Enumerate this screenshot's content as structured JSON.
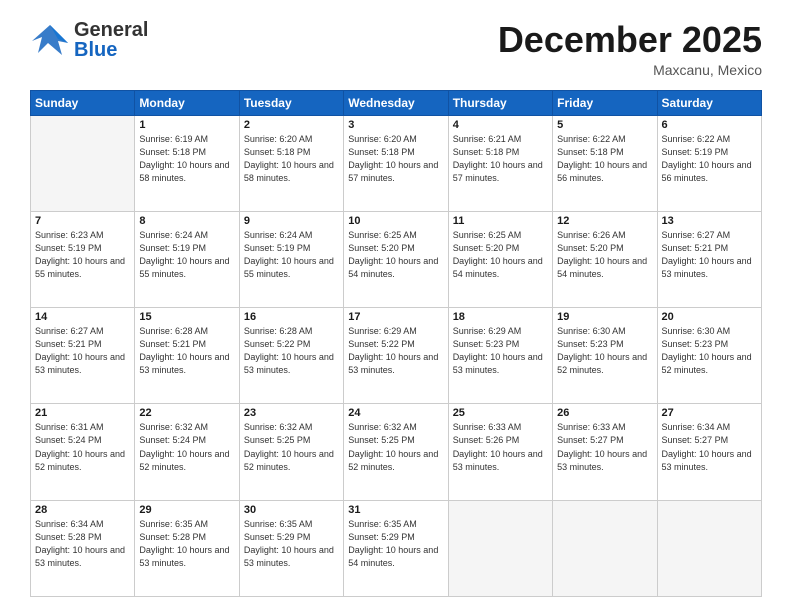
{
  "header": {
    "logo_general": "General",
    "logo_blue": "Blue",
    "month_title": "December 2025",
    "location": "Maxcanu, Mexico"
  },
  "days_of_week": [
    "Sunday",
    "Monday",
    "Tuesday",
    "Wednesday",
    "Thursday",
    "Friday",
    "Saturday"
  ],
  "weeks": [
    [
      {
        "day": "",
        "empty": true
      },
      {
        "day": "1",
        "sunrise": "Sunrise: 6:19 AM",
        "sunset": "Sunset: 5:18 PM",
        "daylight": "Daylight: 10 hours and 58 minutes."
      },
      {
        "day": "2",
        "sunrise": "Sunrise: 6:20 AM",
        "sunset": "Sunset: 5:18 PM",
        "daylight": "Daylight: 10 hours and 58 minutes."
      },
      {
        "day": "3",
        "sunrise": "Sunrise: 6:20 AM",
        "sunset": "Sunset: 5:18 PM",
        "daylight": "Daylight: 10 hours and 57 minutes."
      },
      {
        "day": "4",
        "sunrise": "Sunrise: 6:21 AM",
        "sunset": "Sunset: 5:18 PM",
        "daylight": "Daylight: 10 hours and 57 minutes."
      },
      {
        "day": "5",
        "sunrise": "Sunrise: 6:22 AM",
        "sunset": "Sunset: 5:18 PM",
        "daylight": "Daylight: 10 hours and 56 minutes."
      },
      {
        "day": "6",
        "sunrise": "Sunrise: 6:22 AM",
        "sunset": "Sunset: 5:19 PM",
        "daylight": "Daylight: 10 hours and 56 minutes."
      }
    ],
    [
      {
        "day": "7",
        "sunrise": "Sunrise: 6:23 AM",
        "sunset": "Sunset: 5:19 PM",
        "daylight": "Daylight: 10 hours and 55 minutes."
      },
      {
        "day": "8",
        "sunrise": "Sunrise: 6:24 AM",
        "sunset": "Sunset: 5:19 PM",
        "daylight": "Daylight: 10 hours and 55 minutes."
      },
      {
        "day": "9",
        "sunrise": "Sunrise: 6:24 AM",
        "sunset": "Sunset: 5:19 PM",
        "daylight": "Daylight: 10 hours and 55 minutes."
      },
      {
        "day": "10",
        "sunrise": "Sunrise: 6:25 AM",
        "sunset": "Sunset: 5:20 PM",
        "daylight": "Daylight: 10 hours and 54 minutes."
      },
      {
        "day": "11",
        "sunrise": "Sunrise: 6:25 AM",
        "sunset": "Sunset: 5:20 PM",
        "daylight": "Daylight: 10 hours and 54 minutes."
      },
      {
        "day": "12",
        "sunrise": "Sunrise: 6:26 AM",
        "sunset": "Sunset: 5:20 PM",
        "daylight": "Daylight: 10 hours and 54 minutes."
      },
      {
        "day": "13",
        "sunrise": "Sunrise: 6:27 AM",
        "sunset": "Sunset: 5:21 PM",
        "daylight": "Daylight: 10 hours and 53 minutes."
      }
    ],
    [
      {
        "day": "14",
        "sunrise": "Sunrise: 6:27 AM",
        "sunset": "Sunset: 5:21 PM",
        "daylight": "Daylight: 10 hours and 53 minutes."
      },
      {
        "day": "15",
        "sunrise": "Sunrise: 6:28 AM",
        "sunset": "Sunset: 5:21 PM",
        "daylight": "Daylight: 10 hours and 53 minutes."
      },
      {
        "day": "16",
        "sunrise": "Sunrise: 6:28 AM",
        "sunset": "Sunset: 5:22 PM",
        "daylight": "Daylight: 10 hours and 53 minutes."
      },
      {
        "day": "17",
        "sunrise": "Sunrise: 6:29 AM",
        "sunset": "Sunset: 5:22 PM",
        "daylight": "Daylight: 10 hours and 53 minutes."
      },
      {
        "day": "18",
        "sunrise": "Sunrise: 6:29 AM",
        "sunset": "Sunset: 5:23 PM",
        "daylight": "Daylight: 10 hours and 53 minutes."
      },
      {
        "day": "19",
        "sunrise": "Sunrise: 6:30 AM",
        "sunset": "Sunset: 5:23 PM",
        "daylight": "Daylight: 10 hours and 52 minutes."
      },
      {
        "day": "20",
        "sunrise": "Sunrise: 6:30 AM",
        "sunset": "Sunset: 5:23 PM",
        "daylight": "Daylight: 10 hours and 52 minutes."
      }
    ],
    [
      {
        "day": "21",
        "sunrise": "Sunrise: 6:31 AM",
        "sunset": "Sunset: 5:24 PM",
        "daylight": "Daylight: 10 hours and 52 minutes."
      },
      {
        "day": "22",
        "sunrise": "Sunrise: 6:32 AM",
        "sunset": "Sunset: 5:24 PM",
        "daylight": "Daylight: 10 hours and 52 minutes."
      },
      {
        "day": "23",
        "sunrise": "Sunrise: 6:32 AM",
        "sunset": "Sunset: 5:25 PM",
        "daylight": "Daylight: 10 hours and 52 minutes."
      },
      {
        "day": "24",
        "sunrise": "Sunrise: 6:32 AM",
        "sunset": "Sunset: 5:25 PM",
        "daylight": "Daylight: 10 hours and 52 minutes."
      },
      {
        "day": "25",
        "sunrise": "Sunrise: 6:33 AM",
        "sunset": "Sunset: 5:26 PM",
        "daylight": "Daylight: 10 hours and 53 minutes."
      },
      {
        "day": "26",
        "sunrise": "Sunrise: 6:33 AM",
        "sunset": "Sunset: 5:27 PM",
        "daylight": "Daylight: 10 hours and 53 minutes."
      },
      {
        "day": "27",
        "sunrise": "Sunrise: 6:34 AM",
        "sunset": "Sunset: 5:27 PM",
        "daylight": "Daylight: 10 hours and 53 minutes."
      }
    ],
    [
      {
        "day": "28",
        "sunrise": "Sunrise: 6:34 AM",
        "sunset": "Sunset: 5:28 PM",
        "daylight": "Daylight: 10 hours and 53 minutes."
      },
      {
        "day": "29",
        "sunrise": "Sunrise: 6:35 AM",
        "sunset": "Sunset: 5:28 PM",
        "daylight": "Daylight: 10 hours and 53 minutes."
      },
      {
        "day": "30",
        "sunrise": "Sunrise: 6:35 AM",
        "sunset": "Sunset: 5:29 PM",
        "daylight": "Daylight: 10 hours and 53 minutes."
      },
      {
        "day": "31",
        "sunrise": "Sunrise: 6:35 AM",
        "sunset": "Sunset: 5:29 PM",
        "daylight": "Daylight: 10 hours and 54 minutes."
      },
      {
        "day": "",
        "empty": true
      },
      {
        "day": "",
        "empty": true
      },
      {
        "day": "",
        "empty": true
      }
    ]
  ]
}
